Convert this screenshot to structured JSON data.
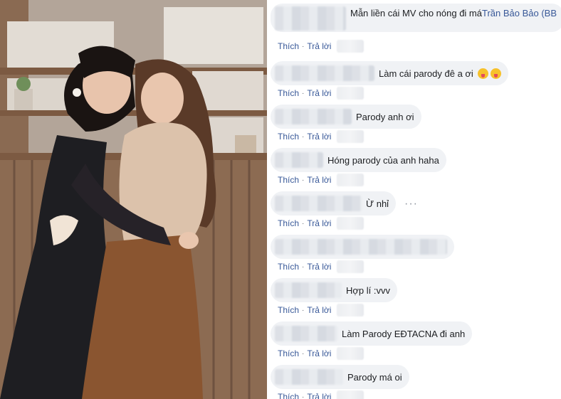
{
  "photo": {
    "alt_icon": "photo-image"
  },
  "comments": [
    {
      "text": "Mẫn liền cái MV cho nóng đi má ",
      "mention": "Trần Bảo Bảo (BB",
      "emoji_count": 0,
      "like": "Thích",
      "reply": "Trả lời",
      "blur_w": 100,
      "two_line": true
    },
    {
      "text": "Làm cái parody đê a ơi",
      "mention": "",
      "emoji_count": 2,
      "like": "Thích",
      "reply": "Trả lời",
      "blur_w": 140
    },
    {
      "text": "Parody anh ơi",
      "mention": "",
      "emoji_count": 0,
      "like": "Thích",
      "reply": "Trả lời",
      "blur_w": 108
    },
    {
      "text": "Hóng parody của anh haha",
      "mention": "",
      "emoji_count": 0,
      "like": "Thích",
      "reply": "Trả lời",
      "blur_w": 68
    },
    {
      "text": "Ừ nhỉ",
      "mention": "",
      "emoji_count": 0,
      "like": "Thích",
      "reply": "Trả lời",
      "blur_w": 122,
      "has_more": true,
      "more_label": "···"
    },
    {
      "text": "",
      "mention": "",
      "emoji_count": 0,
      "like": "Thích",
      "reply": "Trả lời",
      "blur_w": 242
    },
    {
      "text": "Hợp lí :vvv",
      "mention": "",
      "emoji_count": 0,
      "like": "Thích",
      "reply": "Trả lời",
      "blur_w": 94
    },
    {
      "text": "Làm Parody EĐTACNA đi anh",
      "mention": "",
      "emoji_count": 0,
      "like": "Thích",
      "reply": "Trả lời",
      "blur_w": 88
    },
    {
      "text": "Parody má oi",
      "mention": "",
      "emoji_count": 0,
      "like": "Thích",
      "reply": "Trả lời",
      "blur_w": 96
    }
  ],
  "colors": {
    "link": "#385898",
    "bubble": "#f0f2f5",
    "text": "#1c1e21"
  }
}
